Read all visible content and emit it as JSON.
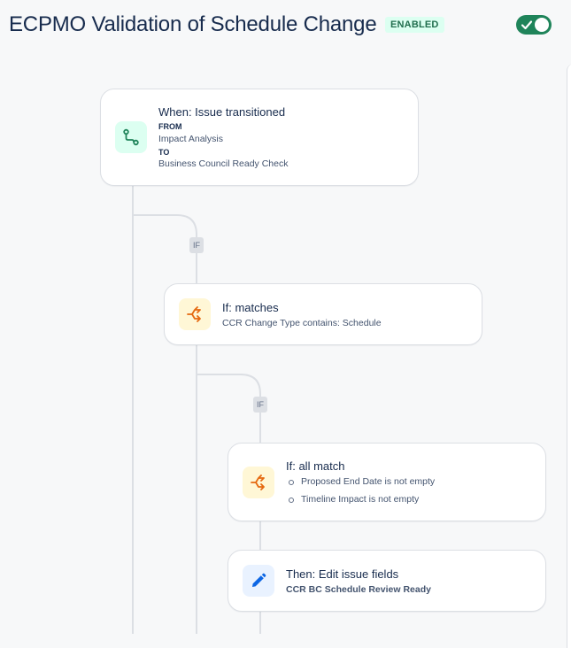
{
  "header": {
    "title": "ECPMO Validation of Schedule Change",
    "status_badge": "ENABLED",
    "toggle_on": true
  },
  "trigger": {
    "title": "When: Issue transitioned",
    "from_label": "FROM",
    "from_value": "Impact Analysis",
    "to_label": "TO",
    "to_value": "Business Council Ready Check",
    "icon": "transition-icon"
  },
  "branch_tags": [
    "IF",
    "IF"
  ],
  "condition_1": {
    "title": "If: matches",
    "detail": "CCR Change Type contains: Schedule",
    "icon": "branch-condition-icon"
  },
  "condition_2": {
    "title": "If: all match",
    "items": [
      "Proposed End Date is not empty",
      "Timeline Impact is not empty"
    ],
    "icon": "branch-condition-icon"
  },
  "action": {
    "title": "Then: Edit issue fields",
    "detail": "CCR BC Schedule Review Ready",
    "icon": "pencil-icon"
  },
  "colors": {
    "toggle": "#1f845a",
    "badge_bg": "#dcfff1",
    "badge_text": "#216e4e",
    "trigger_icon": "#1f845a",
    "condition_icon": "#e56910",
    "action_icon": "#0c66e4",
    "connector": "#dcdfe4"
  }
}
